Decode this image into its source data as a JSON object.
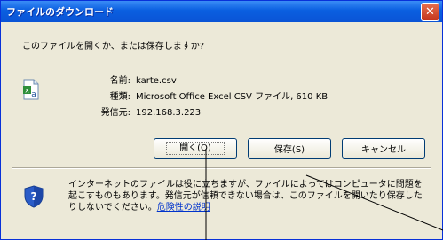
{
  "window": {
    "title": "ファイルのダウンロード",
    "close_glyph": "✕"
  },
  "question": "このファイルを開くか、または保存しますか?",
  "file": {
    "icon": "excel-csv-file-icon",
    "name_label": "名前:",
    "name": "karte.csv",
    "type_label": "種類:",
    "type": "Microsoft Office Excel CSV ファイル, 610 KB",
    "from_label": "発信元:",
    "from": "192.168.3.223"
  },
  "buttons": {
    "open": "開く(O)",
    "save": "保存(S)",
    "cancel": "キャンセル"
  },
  "warning": {
    "text": "インターネットのファイルは役に立ちますが、ファイルによってはコンピュータに問題を起こすものもあります。発信元が信頼できない場合は、このファイルを開いたり保存したりしないでください。",
    "link": "危険性の説明"
  },
  "colors": {
    "titlebar": "#0a54d6",
    "close": "#c3351c",
    "dialog_bg": "#ece9d8",
    "link": "#0033cc"
  }
}
